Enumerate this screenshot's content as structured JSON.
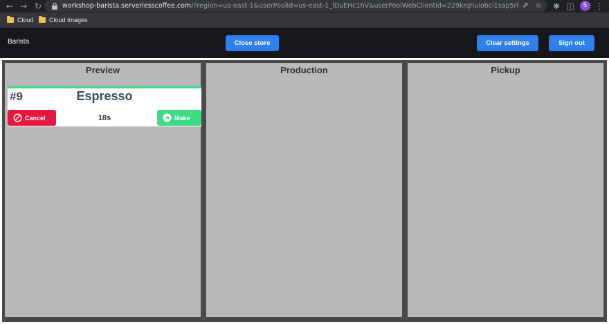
{
  "browser": {
    "url_host": "workshop-barista.serverlesscoffee.com",
    "url_path": "/?region=us-east-1&userPoolId=us-east-1_lDuEHc1hV&userPoolWebClientId=229krqhuiobci1sap5rl0l5hhg&poolId=us-eas...",
    "profile_initial": "S",
    "icons": [
      "back-icon",
      "forward-icon",
      "reload-icon",
      "lock-icon",
      "share-icon",
      "star-icon",
      "extensions-icon",
      "side-panel-icon",
      "menu-icon"
    ]
  },
  "bookmarks": [
    {
      "label": "Cloud"
    },
    {
      "label": "Cloud Images"
    }
  ],
  "header": {
    "brand": "Barista",
    "close_store": "Close store",
    "clear_settings": "Clear settings",
    "sign_out": "Sign out"
  },
  "columns": [
    {
      "title": "Preview"
    },
    {
      "title": "Production"
    },
    {
      "title": "Pickup"
    }
  ],
  "order": {
    "number": "#9",
    "drink": "Espresso",
    "elapsed": "18s",
    "cancel_label": "Cancel",
    "make_label": "Make"
  },
  "colors": {
    "primary_button": "#2f80ed",
    "cancel": "#e8173f",
    "make": "#3ddc84",
    "header_bg": "#15171b",
    "column_bg": "#b9b9b9",
    "board_border": "#4a4a4a"
  }
}
